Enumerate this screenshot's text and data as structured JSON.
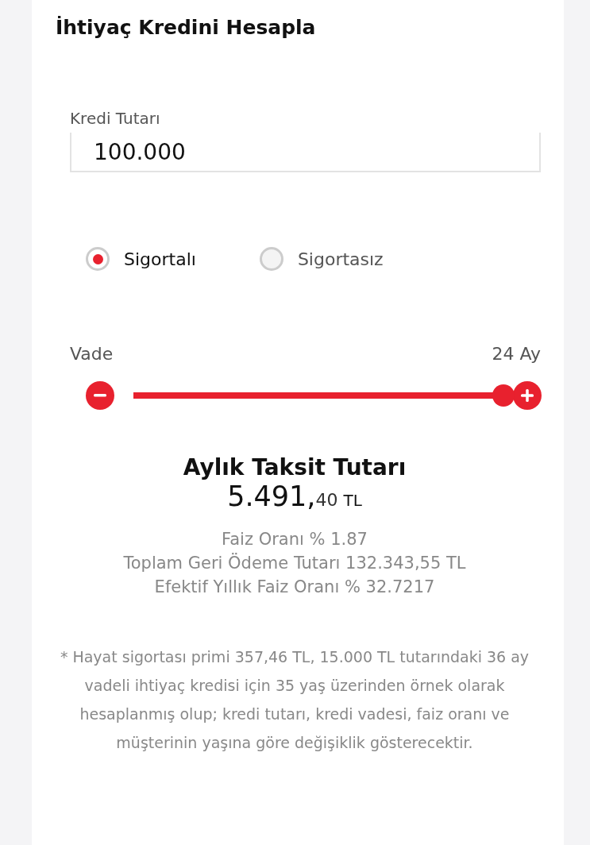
{
  "title": "İhtiyaç Kredini Hesapla",
  "amount_field": {
    "label": "Kredi Tutarı",
    "value": "100.000"
  },
  "insurance_options": [
    {
      "label": "Sigortalı",
      "selected": true
    },
    {
      "label": "Sigortasız",
      "selected": false
    }
  ],
  "term": {
    "label": "Vade",
    "reading": "24 Ay",
    "level": 1
  },
  "result": {
    "title": "Aylık Taksit Tutarı",
    "amount_whole": "5.491,",
    "amount_fraction": "40",
    "currency": "TL"
  },
  "details": [
    "Faiz Oranı % 1.87",
    "Toplam Geri Ödeme Tutarı 132.343,55 TL",
    "Efektif Yıllık Faiz Oranı % 32.7217"
  ],
  "footnote": "* Hayat sigortası primi 357,46 TL, 15.000 TL tutarındaki 36 ay vadeli ihtiyaç kredisi için 35 yaş üzerinden örnek olarak hesaplanmış olup; kredi tutarı, kredi vadesi, faiz oranı ve müşterinin yaşına göre değişiklik gösterecektir."
}
